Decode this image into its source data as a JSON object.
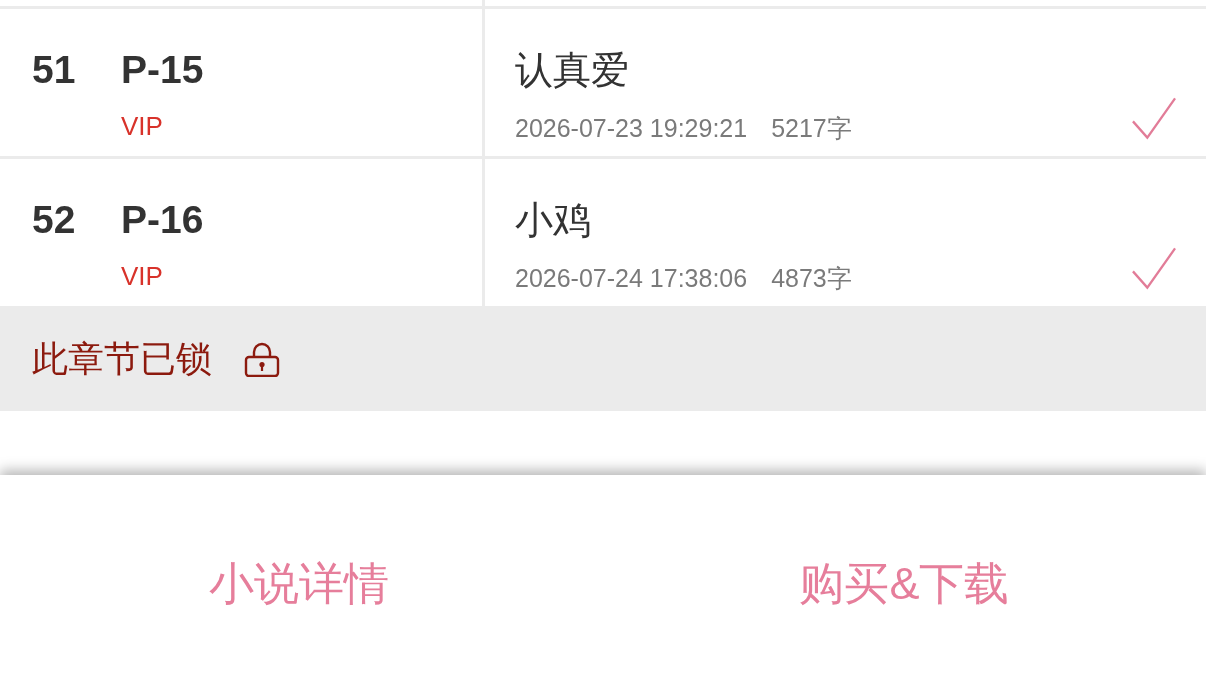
{
  "chapters": [
    {
      "index": "51",
      "code": "P-15",
      "badge": "VIP",
      "title": "认真爱",
      "timestamp": "2026-07-23 19:29:21",
      "word_count": "5217字",
      "checked": true
    },
    {
      "index": "52",
      "code": "P-16",
      "badge": "VIP",
      "title": "小鸡",
      "timestamp": "2026-07-24 17:38:06",
      "word_count": "4873字",
      "checked": true
    }
  ],
  "locked_notice": {
    "text": "此章节已锁"
  },
  "actions": [
    {
      "label": "小说详情"
    },
    {
      "label": "购买&下载"
    }
  ]
}
